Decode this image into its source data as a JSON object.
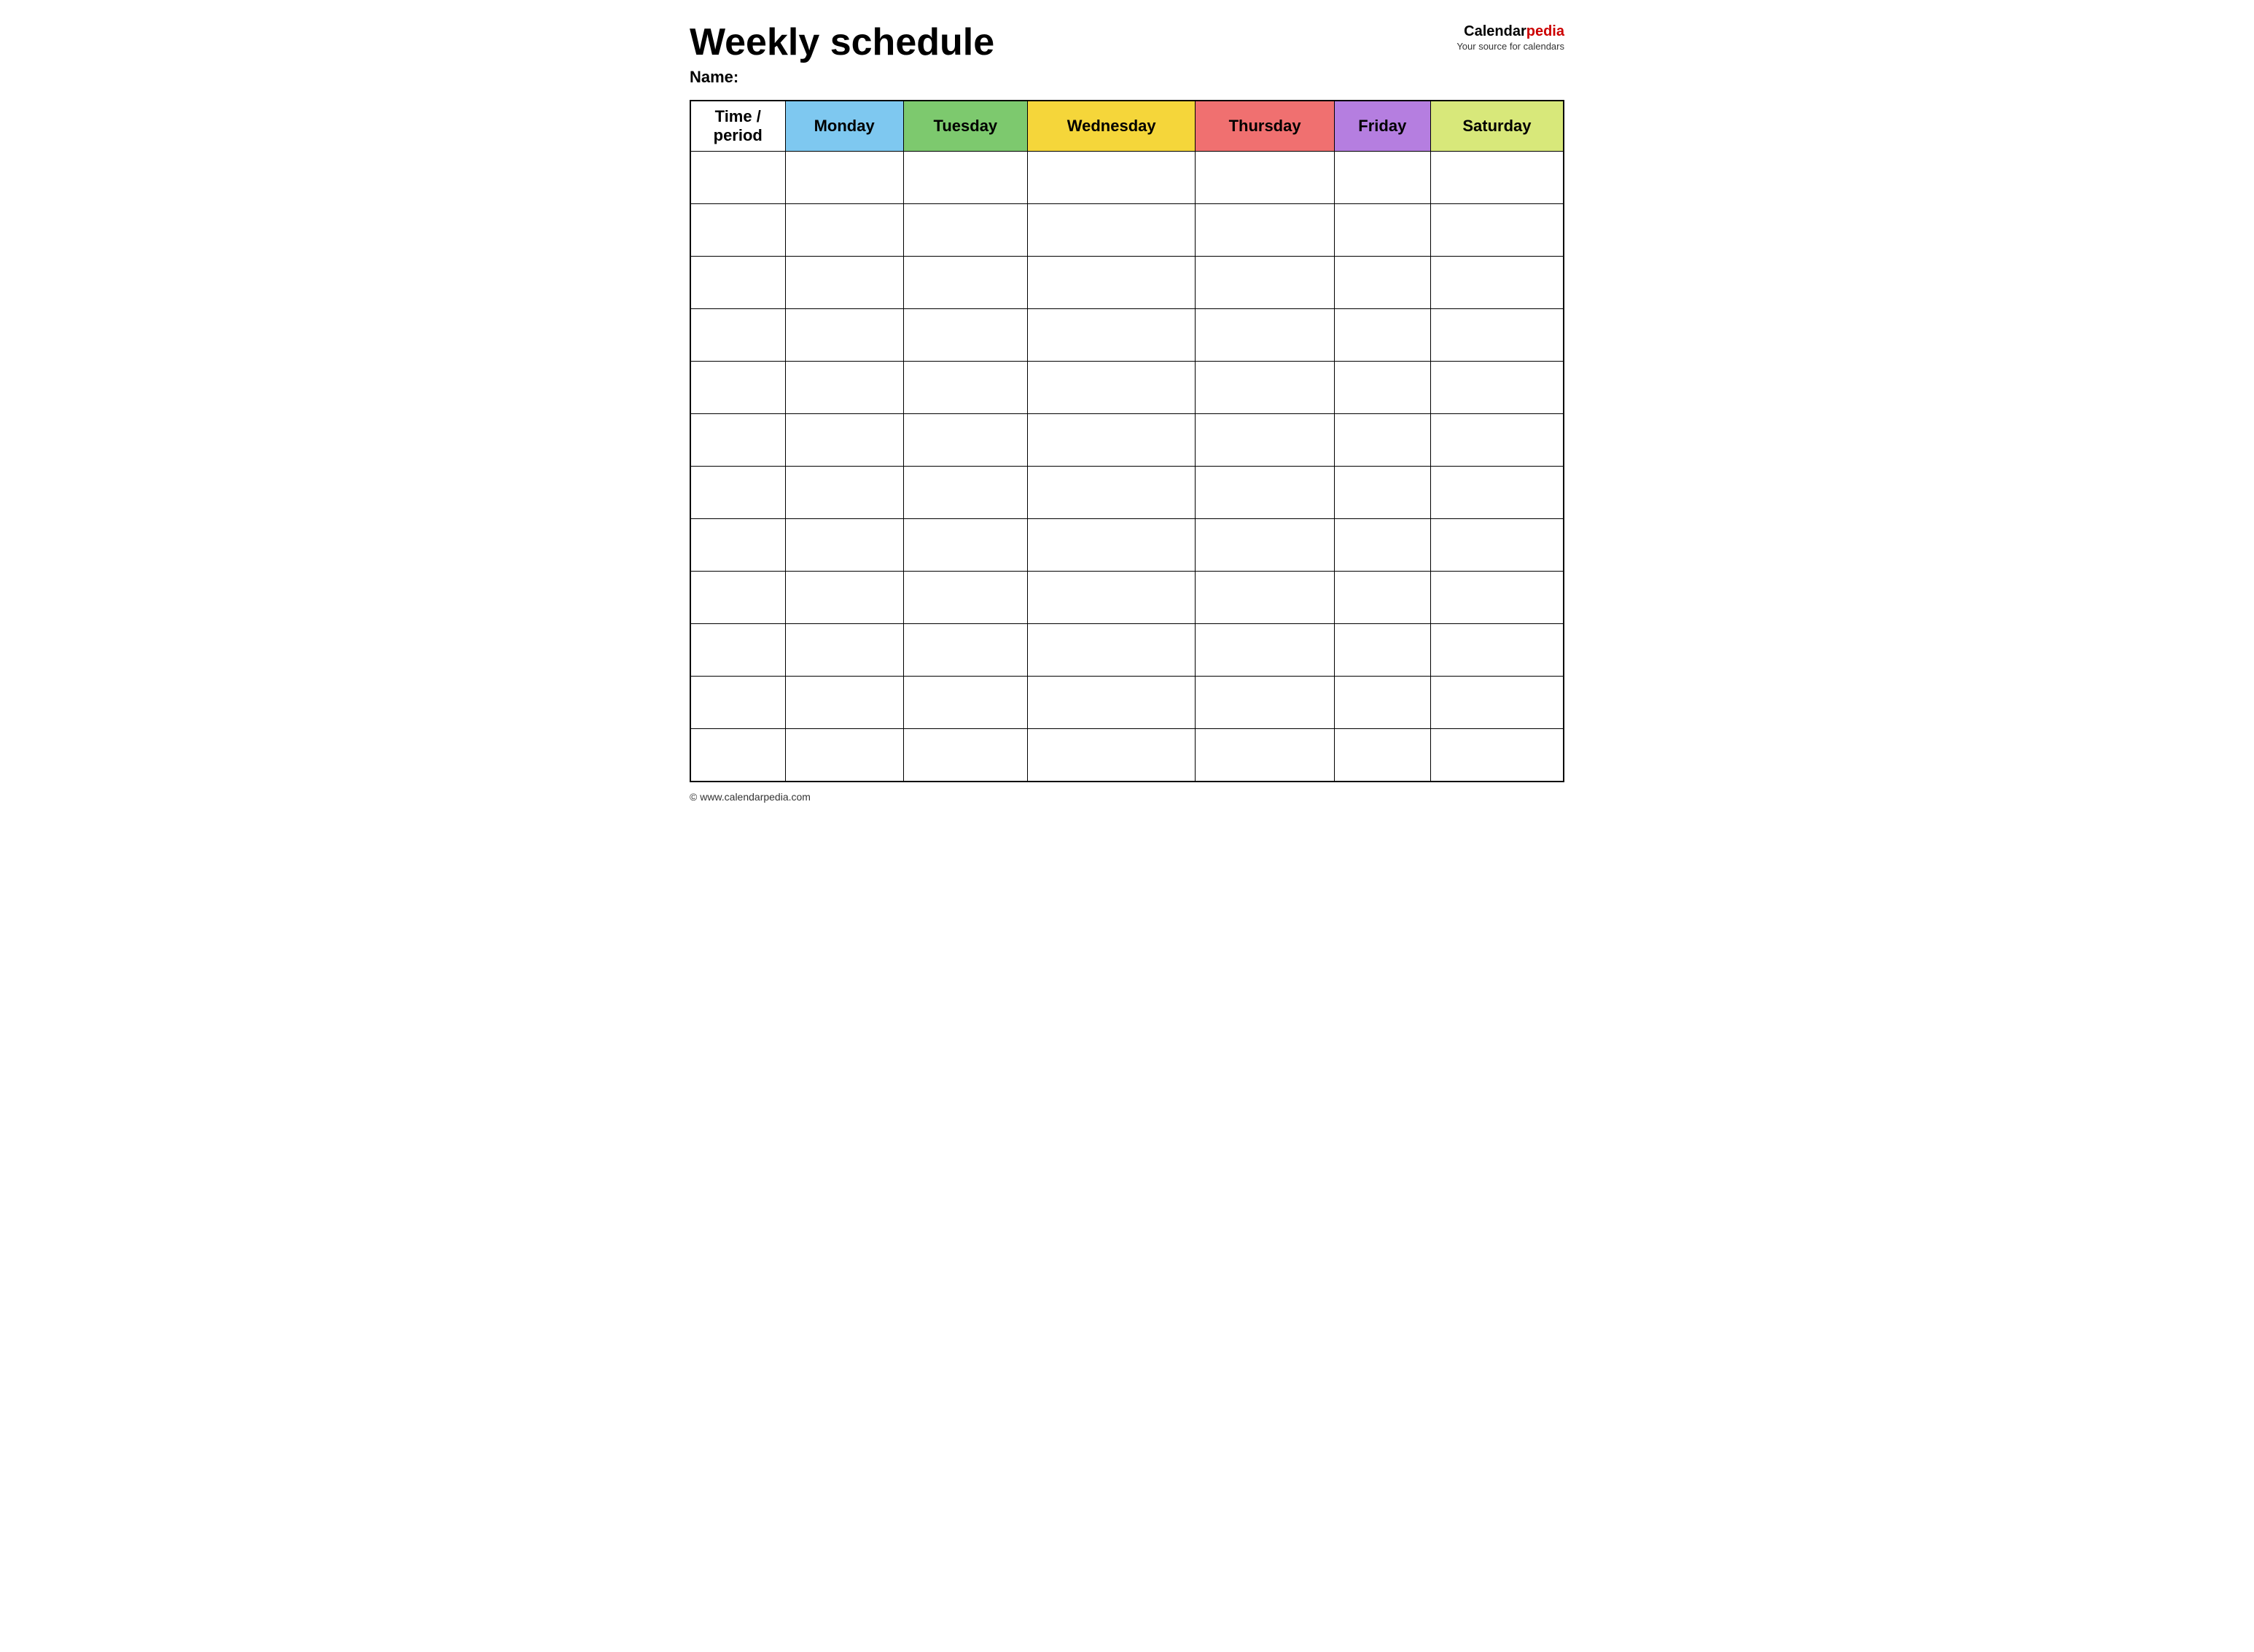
{
  "header": {
    "title": "Weekly schedule",
    "name_label": "Name:",
    "logo_calendar": "Calendar",
    "logo_pedia": "pedia",
    "logo_tagline": "Your source for calendars"
  },
  "table": {
    "columns": [
      {
        "key": "time",
        "label": "Time / period",
        "color_class": "th-time"
      },
      {
        "key": "monday",
        "label": "Monday",
        "color_class": "th-monday"
      },
      {
        "key": "tuesday",
        "label": "Tuesday",
        "color_class": "th-tuesday"
      },
      {
        "key": "wednesday",
        "label": "Wednesday",
        "color_class": "th-wednesday"
      },
      {
        "key": "thursday",
        "label": "Thursday",
        "color_class": "th-thursday"
      },
      {
        "key": "friday",
        "label": "Friday",
        "color_class": "th-friday"
      },
      {
        "key": "saturday",
        "label": "Saturday",
        "color_class": "th-saturday"
      }
    ],
    "rows": 12
  },
  "footer": {
    "text": "© www.calendarpedia.com"
  }
}
